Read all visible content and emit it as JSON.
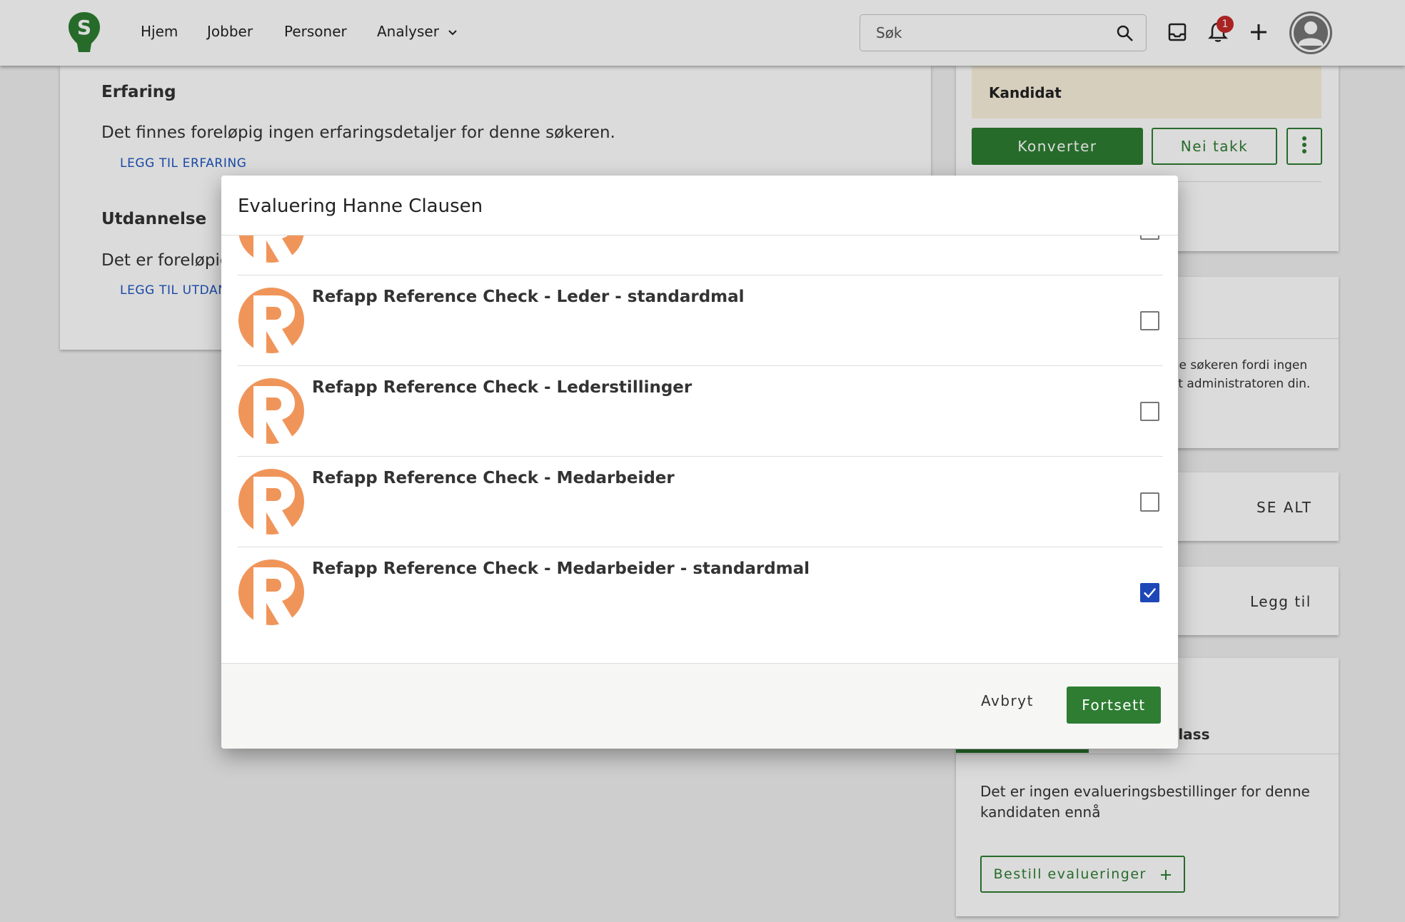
{
  "nav": {
    "logo_letter": "S",
    "links": [
      "Hjem",
      "Jobber",
      "Personer",
      "Analyser"
    ],
    "search_placeholder": "Søk",
    "notification_count": "1"
  },
  "profile": {
    "experience": {
      "title": "Erfaring",
      "text": "Det finnes foreløpig ingen erfaringsdetaljer for denne søkeren.",
      "link": "LEGG TIL ERFARING"
    },
    "education": {
      "title": "Utdannelse",
      "text": "Det er foreløpig",
      "link": "LEGG TIL UTDANN"
    }
  },
  "sidebar": {
    "status": "Kandidat",
    "convert_label": "Konverter",
    "decline_label": "Nei takk",
    "notice_line1": "nne søkeren fordi ingen",
    "notice_line2": "akt administratoren din.",
    "see_all_label": "SE ALT",
    "add_label": "Legg til",
    "tab_partial": "plass",
    "evaluations_empty_line1": "Det er ingen evalueringsbestillinger for denne",
    "evaluations_empty_line2": "kandidaten ennå",
    "order_label": "Bestill evalueringer"
  },
  "modal": {
    "title": "Evaluering Hanne Clausen",
    "items": [
      {
        "label": "",
        "checked": false,
        "logo": "refapp-logo-icon"
      },
      {
        "label": "Refapp Reference Check - Leder - standardmal",
        "checked": false,
        "logo": "refapp-logo-icon"
      },
      {
        "label": "Refapp Reference Check - Lederstillinger",
        "checked": false,
        "logo": "refapp-logo-icon"
      },
      {
        "label": "Refapp Reference Check - Medarbeider",
        "checked": false,
        "logo": "refapp-logo-icon"
      },
      {
        "label": "Refapp Reference Check - Medarbeider - standardmal",
        "checked": true,
        "logo": "refapp-logo-icon"
      }
    ],
    "cancel_label": "Avbryt",
    "continue_label": "Fortsett"
  },
  "colors": {
    "brand_green": "#2e7d32",
    "refapp_orange": "#f0955a",
    "link_blue": "#1e56c2",
    "checkbox_blue": "#1e47b7",
    "badge_red": "#c62828"
  }
}
